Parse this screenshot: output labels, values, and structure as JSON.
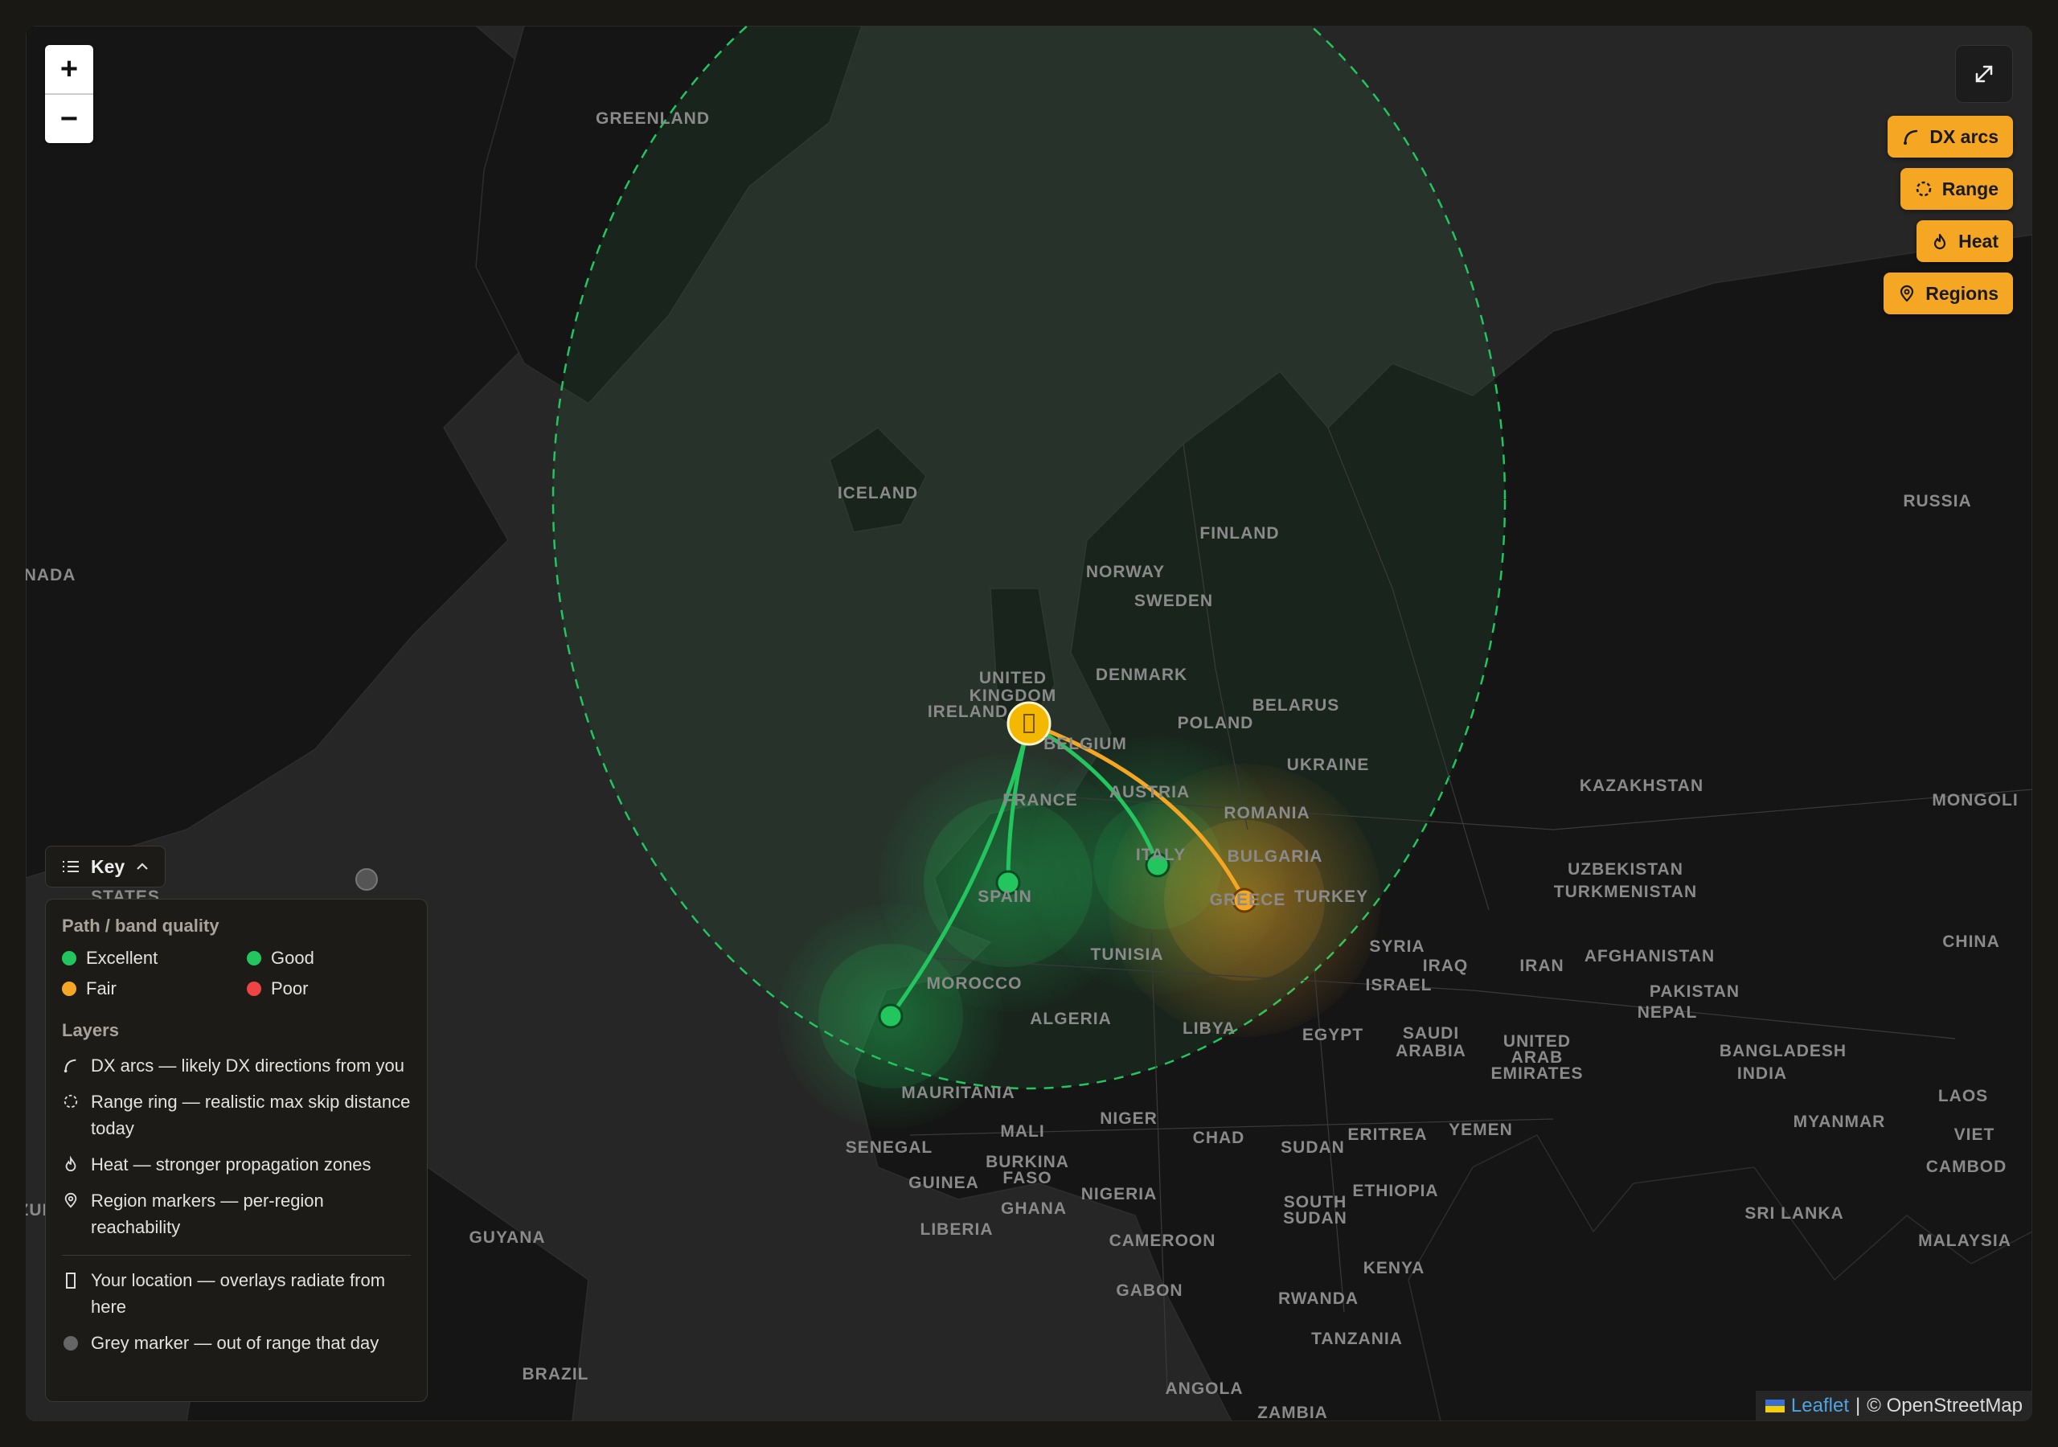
{
  "map": {
    "zoom_in": "+",
    "zoom_out": "−",
    "country_labels": [
      {
        "text": "GREENLAND"
      },
      {
        "text": "ICELAND"
      },
      {
        "text": "NORWAY"
      },
      {
        "text": "SWEDEN"
      },
      {
        "text": "FINLAND"
      },
      {
        "text": "RUSSIA"
      },
      {
        "text": "ANADA"
      },
      {
        "text": "DENMARK"
      },
      {
        "text": "UNITED"
      },
      {
        "text": "KINGDOM"
      },
      {
        "text": "IRELAND"
      },
      {
        "text": "BELGIUM"
      },
      {
        "text": "POLAND"
      },
      {
        "text": "BELARUS"
      },
      {
        "text": "UKRAINE"
      },
      {
        "text": "KAZAKHSTAN"
      },
      {
        "text": "MONGOLI"
      },
      {
        "text": "FRANCE"
      },
      {
        "text": "AUSTRIA"
      },
      {
        "text": "ROMANIA"
      },
      {
        "text": "BULGARIA"
      },
      {
        "text": "ITALY"
      },
      {
        "text": "SPAIN"
      },
      {
        "text": "GREECE"
      },
      {
        "text": "TURKEY"
      },
      {
        "text": "UZBEKISTAN"
      },
      {
        "text": "TURKMENISTAN"
      },
      {
        "text": "CHINA"
      },
      {
        "text": "STATES"
      },
      {
        "text": "TUNISIA"
      },
      {
        "text": "MOROCCO"
      },
      {
        "text": "ALGERIA"
      },
      {
        "text": "LIBYA"
      },
      {
        "text": "SYRIA"
      },
      {
        "text": "IRAQ"
      },
      {
        "text": "IRAN"
      },
      {
        "text": "AFGHANISTAN"
      },
      {
        "text": "PAKISTAN"
      },
      {
        "text": "ISRAEL"
      },
      {
        "text": "EGYPT"
      },
      {
        "text": "SAUDI"
      },
      {
        "text": "ARABIA"
      },
      {
        "text": "UNITED"
      },
      {
        "text": "ARAB"
      },
      {
        "text": "EMIRATES"
      },
      {
        "text": "NEPAL"
      },
      {
        "text": "BANGLADESH"
      },
      {
        "text": "INDIA"
      },
      {
        "text": "MYANMAR"
      },
      {
        "text": "LAOS"
      },
      {
        "text": "CAMBOD"
      },
      {
        "text": "VIET"
      },
      {
        "text": "MAURITANIA"
      },
      {
        "text": "MALI"
      },
      {
        "text": "NIGER"
      },
      {
        "text": "CHAD"
      },
      {
        "text": "SUDAN"
      },
      {
        "text": "ERITREA"
      },
      {
        "text": "YEMEN"
      },
      {
        "text": "SENEGAL"
      },
      {
        "text": "BURKINA"
      },
      {
        "text": "FASO"
      },
      {
        "text": "GUINEA"
      },
      {
        "text": "NIGERIA"
      },
      {
        "text": "GHANA"
      },
      {
        "text": "LIBERIA"
      },
      {
        "text": "SOUTH"
      },
      {
        "text": "SUDAN"
      },
      {
        "text": "ETHIOPIA"
      },
      {
        "text": "ZUELA"
      },
      {
        "text": "GUYANA"
      },
      {
        "text": "CAMEROON"
      },
      {
        "text": "SRI LANKA"
      },
      {
        "text": "MALAYSIA"
      },
      {
        "text": "KENYA"
      },
      {
        "text": "GABON"
      },
      {
        "text": "RWANDA"
      },
      {
        "text": "TANZANIA"
      },
      {
        "text": "BRAZIL"
      },
      {
        "text": "ANGOLA"
      },
      {
        "text": "ZAMBIA"
      }
    ]
  },
  "layer_buttons": {
    "dx_arcs": "DX arcs",
    "range": "Range",
    "heat": "Heat",
    "regions": "Regions"
  },
  "key_button": "Key",
  "legend": {
    "quality_title": "Path / band quality",
    "quality": [
      {
        "label": "Excellent",
        "color": "#22c55e"
      },
      {
        "label": "Good",
        "color": "#22c55e"
      },
      {
        "label": "Fair",
        "color": "#f5a623"
      },
      {
        "label": "Poor",
        "color": "#ef4444"
      }
    ],
    "layers_title": "Layers",
    "layers": [
      "DX arcs — likely DX directions from you",
      "Range ring — realistic max skip distance today",
      "Heat — stronger propagation zones",
      "Region markers — per-region reachability"
    ],
    "your_location": "Your location — overlays radiate from here",
    "grey_marker": "Grey marker — out of range that day"
  },
  "attribution": {
    "leaflet": "Leaflet",
    "separator": "|",
    "osm": "© OpenStreetMap"
  },
  "colors": {
    "excellent": "#22c55e",
    "fair": "#f5a623",
    "home": "#f5b800",
    "grey": "#888888"
  }
}
